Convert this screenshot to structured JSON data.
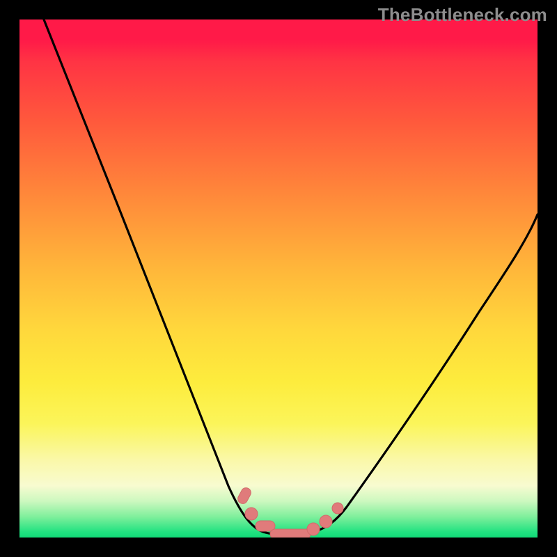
{
  "watermark": "TheBottleneck.com",
  "colors": {
    "frame": "#000000",
    "gradient_top": "#ff1a48",
    "gradient_bottom": "#12db78",
    "curve": "#000000",
    "marker": "#e07b7b",
    "marker_stroke": "#d26a6a"
  },
  "chart_data": {
    "type": "line",
    "title": "",
    "xlabel": "",
    "ylabel": "",
    "xlim": [
      0,
      100
    ],
    "ylim": [
      0,
      100
    ],
    "grid": false,
    "series": [
      {
        "name": "bottleneck-curve",
        "x": [
          4,
          10,
          20,
          30,
          35,
          40,
          44,
          47,
          50,
          53,
          56,
          60,
          65,
          70,
          80,
          90,
          100
        ],
        "values": [
          100,
          85,
          60,
          35,
          22,
          12,
          5,
          2,
          1,
          1,
          2,
          5,
          12,
          20,
          35,
          50,
          63
        ]
      }
    ],
    "annotations": [
      {
        "type": "marker-cluster",
        "xrange": [
          43,
          58
        ],
        "yrange": [
          1,
          6
        ],
        "count": 7
      }
    ]
  }
}
